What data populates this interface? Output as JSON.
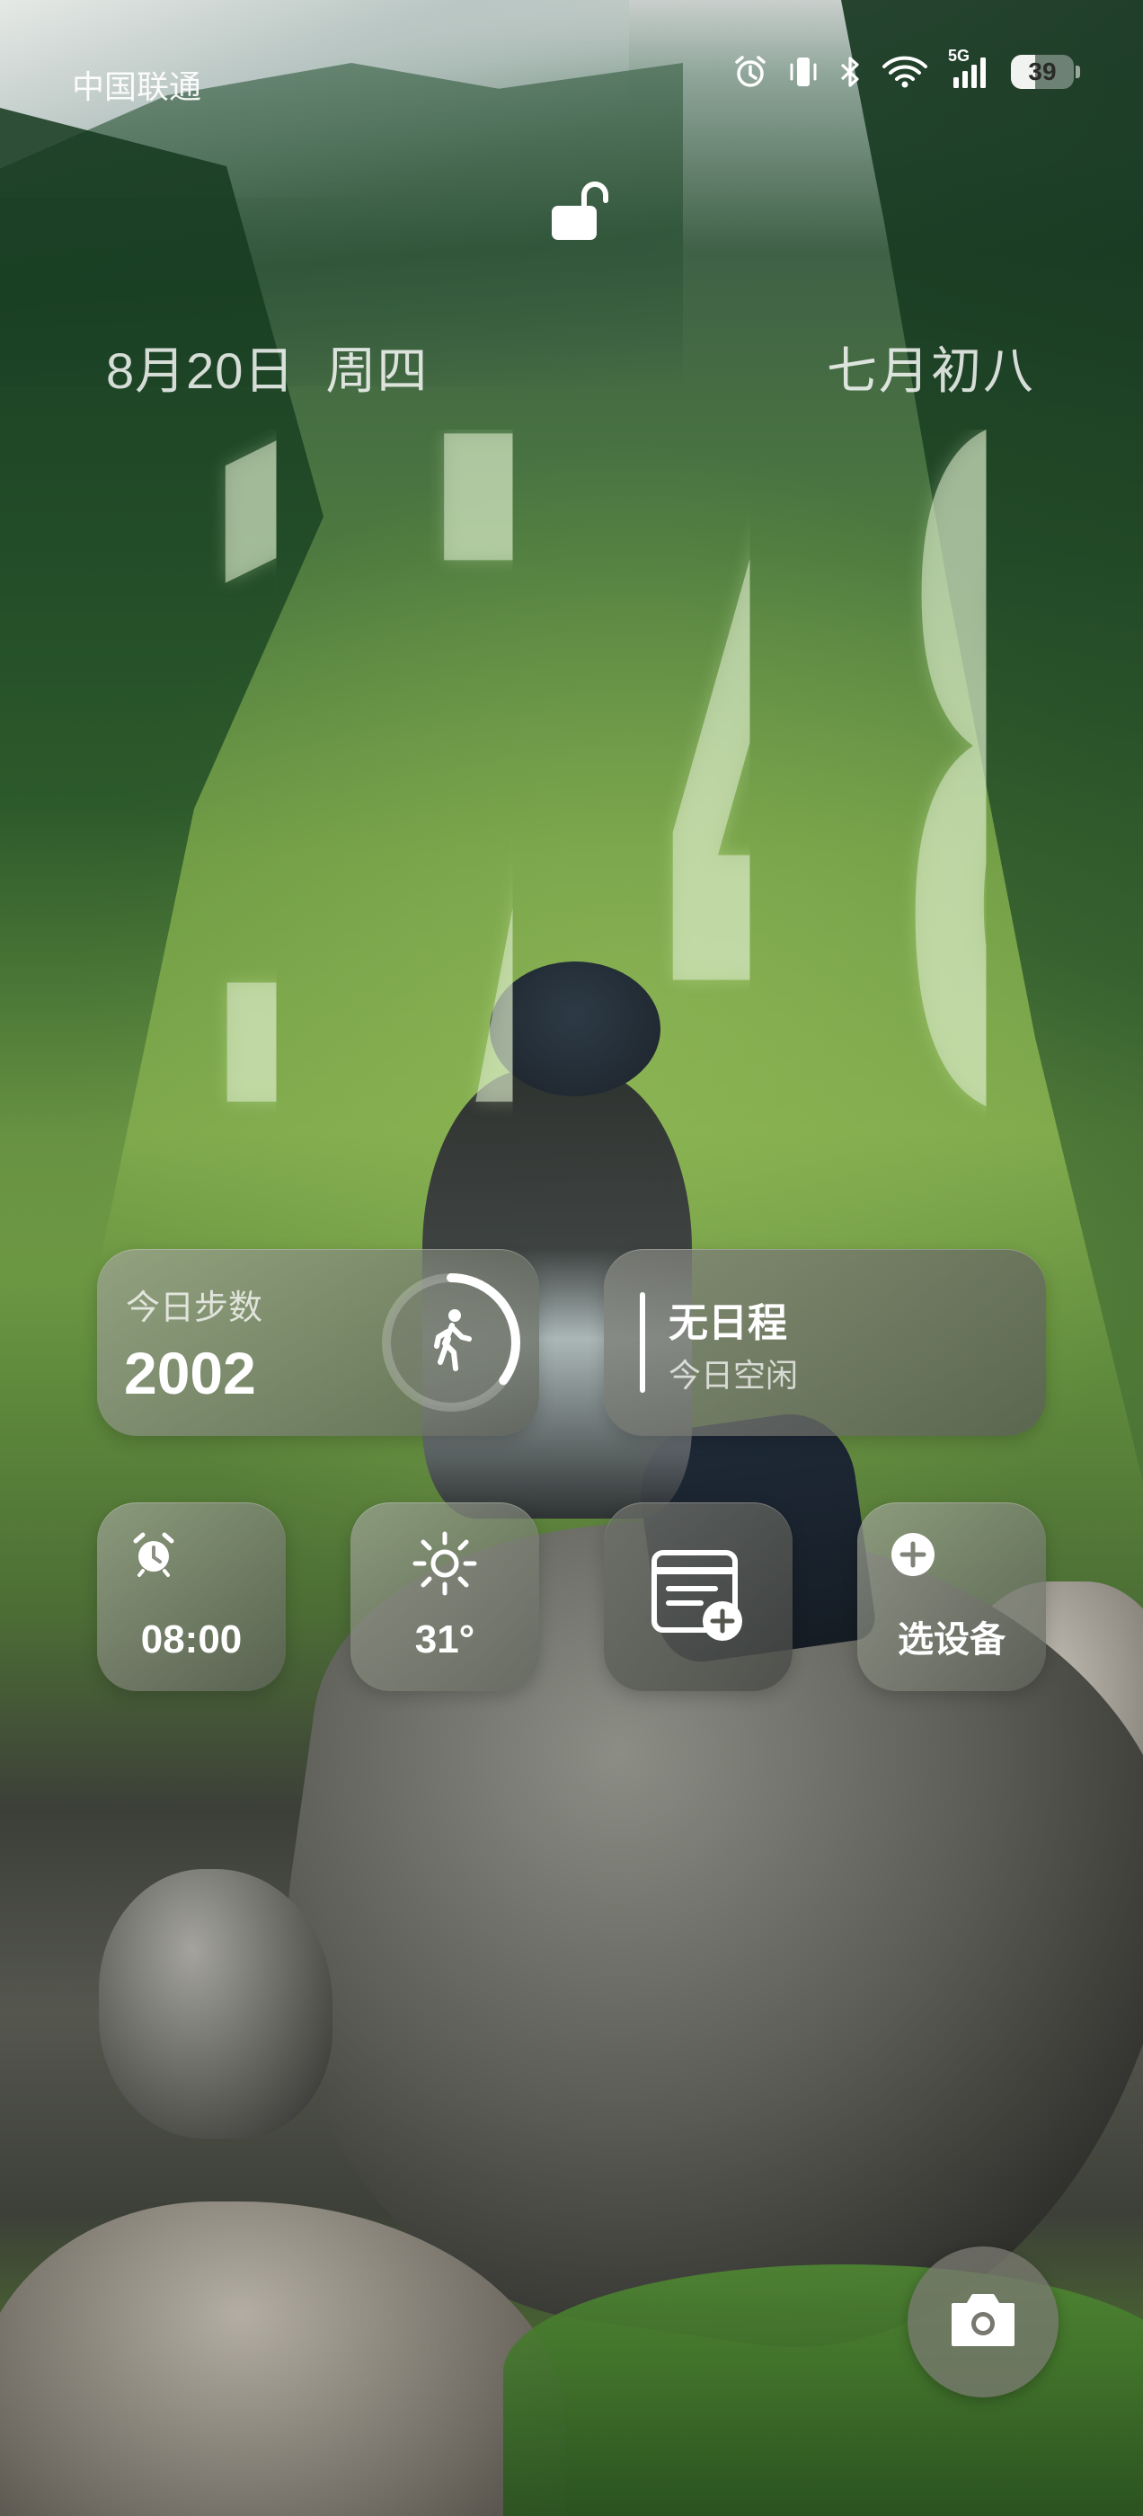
{
  "status_bar": {
    "carrier": "中国联通",
    "network": "5G",
    "battery": "39",
    "battery_level": 0.39,
    "icons": [
      "alarm-icon",
      "vibrate-icon",
      "bluetooth-icon",
      "wifi-icon",
      "signal-icon",
      "battery-icon"
    ]
  },
  "lockscreen": {
    "lock_state": "unlocked",
    "date": "8月20日",
    "weekday": "周四",
    "lunar_date": "七月初八",
    "time": {
      "h1": "1",
      "h2": "7",
      "m1": "4",
      "m2": "8"
    }
  },
  "widgets": {
    "steps": {
      "label": "今日步数",
      "value": "2002",
      "ring_progress": 0.35,
      "icon": "walking-icon"
    },
    "agenda": {
      "title": "无日程",
      "subtitle": "今日空闲"
    },
    "alarm": {
      "time": "08:00",
      "icon": "alarm-clock-icon"
    },
    "weather": {
      "temperature": "31°",
      "icon": "sun-icon"
    },
    "calendar_add": {
      "icon": "calendar-add-icon"
    },
    "device": {
      "label": "选设备",
      "icon": "plus-icon"
    }
  },
  "camera": {
    "icon": "camera-icon"
  },
  "colors": {
    "widget_glass": "#8c9084",
    "clock_tint": "#dcebcd"
  }
}
